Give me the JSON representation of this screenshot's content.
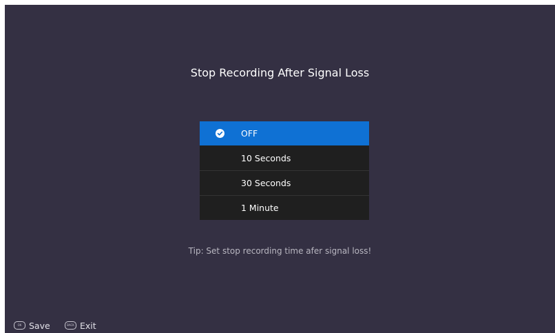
{
  "dialog": {
    "title": "Stop Recording After Signal Loss",
    "options": [
      {
        "label": "OFF",
        "selected": true
      },
      {
        "label": "10 Seconds",
        "selected": false
      },
      {
        "label": "30 Seconds",
        "selected": false
      },
      {
        "label": "1 Minute",
        "selected": false
      }
    ],
    "tip": "Tip: Set stop recording time afer signal loss!"
  },
  "footer": {
    "save_key": "OK",
    "save_label": "Save",
    "exit_key": "BACK",
    "exit_label": "Exit"
  },
  "colors": {
    "background": "#343043",
    "selected": "#0f71d4",
    "list_background": "#1f1f1f"
  }
}
